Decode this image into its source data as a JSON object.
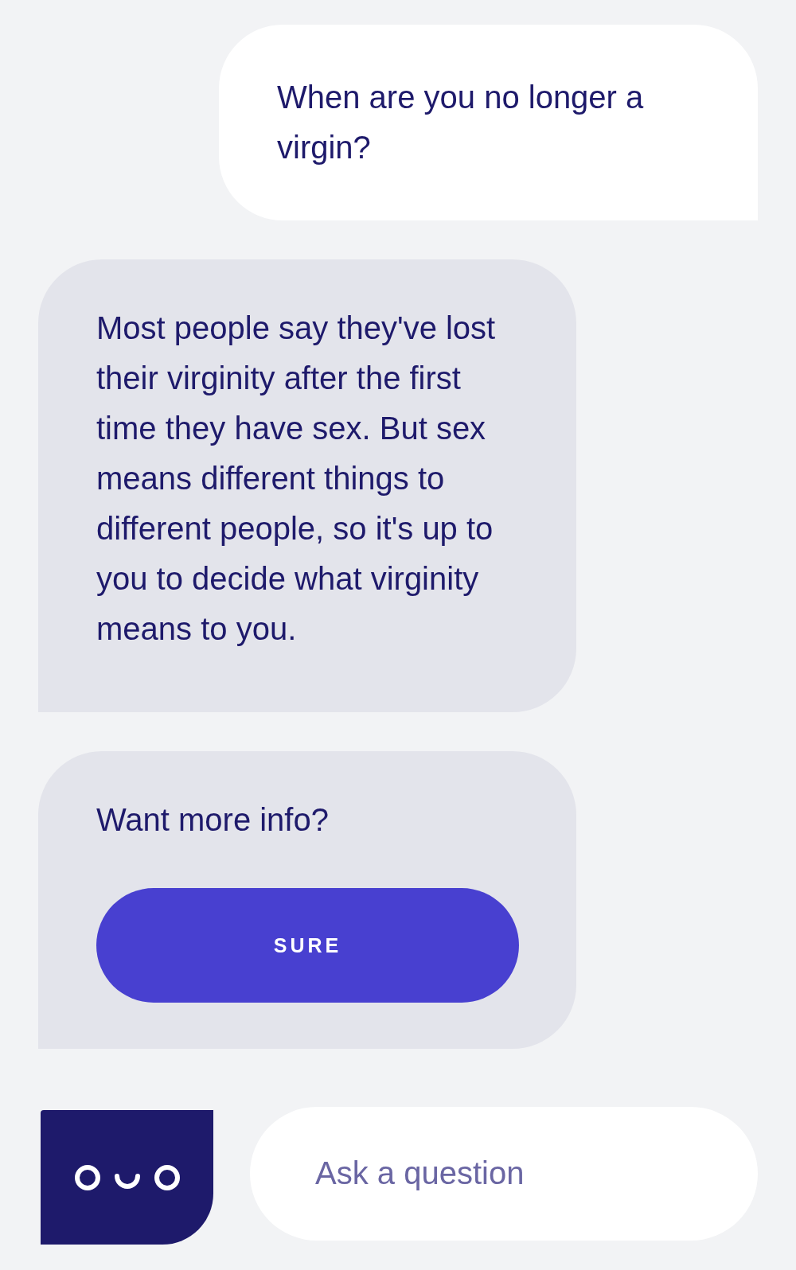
{
  "messages": [
    {
      "kind": "user",
      "text": "When are you no longer a virgin?"
    },
    {
      "kind": "bot",
      "text": "Most people say they've lost their virginity after the first time they have sex. But sex means different things to different people, so it's up to you to decide what virginity means to you."
    },
    {
      "kind": "prompt",
      "text": "Want more info?",
      "button": "SURE"
    }
  ],
  "composer": {
    "placeholder": "Ask a question"
  }
}
